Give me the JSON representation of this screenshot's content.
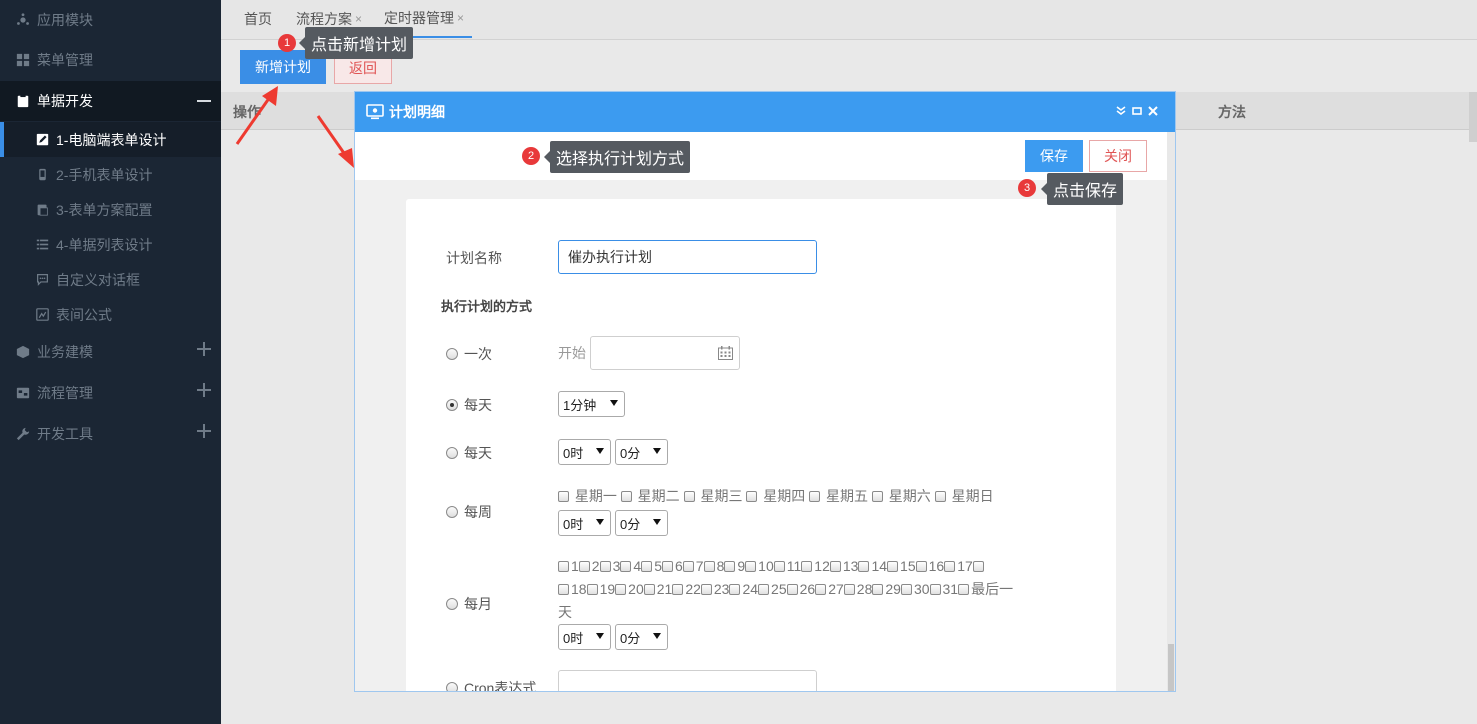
{
  "sidebar": {
    "items": [
      {
        "label": "应用模块",
        "icon": "app-module-icon"
      },
      {
        "label": "菜单管理",
        "icon": "grid-icon"
      },
      {
        "label": "单据开发",
        "icon": "clipboard-icon"
      },
      {
        "label": "业务建模",
        "icon": "cube-icon"
      },
      {
        "label": "流程管理",
        "icon": "flow-icon"
      },
      {
        "label": "开发工具",
        "icon": "wrench-icon"
      }
    ],
    "subitems": [
      {
        "label": "1-电脑端表单设计",
        "icon": "edit-icon"
      },
      {
        "label": "2-手机表单设计",
        "icon": "mobile-icon"
      },
      {
        "label": "3-表单方案配置",
        "icon": "paste-icon"
      },
      {
        "label": "4-单据列表设计",
        "icon": "list-icon"
      },
      {
        "label": "自定义对话框",
        "icon": "chat-icon"
      },
      {
        "label": "表间公式",
        "icon": "formula-icon"
      }
    ]
  },
  "tabs": [
    {
      "label": "首页"
    },
    {
      "label": "流程方案"
    },
    {
      "label": "定时器管理"
    }
  ],
  "tab_close": "×",
  "toolbar": {
    "add_label": "新增计划",
    "back_label": "返回"
  },
  "grid": {
    "col_action": "操作",
    "col_method": "方法"
  },
  "tips": {
    "t1": "点击新增计划",
    "n1": "1",
    "t2": "选择执行计划方式",
    "n2": "2",
    "t3": "点击保存",
    "n3": "3"
  },
  "modal": {
    "title": "计划明细",
    "save_label": "保存",
    "close_label": "关闭",
    "plan_name_label": "计划名称",
    "plan_name_value": "催办执行计划",
    "section_title": "执行计划的方式",
    "once_label": "一次",
    "start_label": "开始",
    "daily_label": "每天",
    "daily_interval": "1分钟",
    "daily2_label": "每天",
    "hour_value": "0时",
    "minute_value": "0分",
    "weekly_label": "每周",
    "weekdays": [
      "星期一",
      "星期二",
      "星期三",
      "星期四",
      "星期五",
      "星期六",
      "星期日"
    ],
    "monthly_label": "每月",
    "month_days_row1": [
      "1",
      "2",
      "3",
      "4",
      "5",
      "6",
      "7",
      "8",
      "9",
      "10",
      "11",
      "12",
      "13",
      "14",
      "15",
      "16",
      "17"
    ],
    "month_days_row2": [
      "18",
      "19",
      "20",
      "21",
      "22",
      "23",
      "24",
      "25",
      "26",
      "27",
      "28",
      "29",
      "30",
      "31",
      "最后一"
    ],
    "month_days_row3": "天",
    "cron_label": "Cron表达式"
  }
}
